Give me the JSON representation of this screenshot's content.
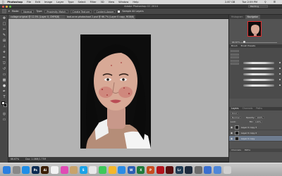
{
  "menubar": {
    "app_name": "Photoshop",
    "items": [
      "File",
      "Edit",
      "Image",
      "Layer",
      "Type",
      "Select",
      "Filter",
      "3D",
      "View",
      "Window",
      "Help"
    ],
    "status": [
      "2.87 GB",
      "Tue 2:59 PM"
    ]
  },
  "window": {
    "title": "Adobe Photoshop CC 2014",
    "workspace": "Painting"
  },
  "options_bar": {
    "mode_label": "Mode:",
    "mode_value": "Normal",
    "type_label": "Type:",
    "type_options": [
      "Proximity Match",
      "Create Texture",
      "Content-Aware"
    ],
    "sample_all_layers": "Sample All Layers"
  },
  "document": {
    "tab_label": "collage original @ 12.5% (Layer 0, CMYK/8)",
    "tab_label_2": "bad-acne-photoshoot 2.psd @ 66.7% (Layer 0 copy, RGB/8)",
    "status_zoom": "66.67%",
    "status_doc": "Doc: 1.06M/1.77M"
  },
  "panels": {
    "nav_tabs": [
      "Histogram",
      "Navigator"
    ],
    "nav_zoom": "66.67%",
    "brush_tabs": [
      "Brush",
      "Brush Presets"
    ],
    "layers_tabs": [
      "Layers",
      "Channels",
      "Paths"
    ],
    "layers_kind": "Kind",
    "blend_mode": "Normal",
    "opacity_label": "Opacity:",
    "opacity_value": "100%",
    "lock_label": "Lock:",
    "fill_label": "Fill:",
    "fill_value": "100%",
    "layers": [
      {
        "name": "Layer 0 copy 3",
        "selected": false
      },
      {
        "name": "Layer 0 copy 2",
        "selected": false
      },
      {
        "name": "Layer 0 copy",
        "selected": true
      }
    ],
    "footer_tabs": [
      "Channels",
      "Paths"
    ]
  },
  "dock": {
    "apps": [
      {
        "name": "finder-icon",
        "color": "#2a7fe0",
        "label": ""
      },
      {
        "name": "launchpad-icon",
        "color": "#888888",
        "label": ""
      },
      {
        "name": "safari-icon",
        "color": "#1f8ee8",
        "label": ""
      },
      {
        "name": "photoshop-icon",
        "color": "#0b2b52",
        "label": "Ps"
      },
      {
        "name": "illustrator-icon",
        "color": "#3b1e00",
        "label": "Ai"
      },
      {
        "name": "calendar-icon",
        "color": "#f2f2f2",
        "label": ""
      },
      {
        "name": "itunes-icon",
        "color": "#e04bb5",
        "label": ""
      },
      {
        "name": "contacts-icon",
        "color": "#c8a36b",
        "label": ""
      },
      {
        "name": "skype-icon",
        "color": "#1ba3e8",
        "label": "S"
      },
      {
        "name": "chrome-icon",
        "color": "#e8e8e8",
        "label": ""
      },
      {
        "name": "messages-icon",
        "color": "#3dc95a",
        "label": ""
      },
      {
        "name": "sketch-icon",
        "color": "#f5b72a",
        "label": ""
      },
      {
        "name": "app-store-icon",
        "color": "#2b8ce6",
        "label": ""
      },
      {
        "name": "word-icon",
        "color": "#2b5fb4",
        "label": "W"
      },
      {
        "name": "excel-icon",
        "color": "#1f7a3a",
        "label": "X"
      },
      {
        "name": "powerpoint-icon",
        "color": "#c84b1f",
        "label": "P"
      },
      {
        "name": "acrobat-icon",
        "color": "#b3121b",
        "label": ""
      },
      {
        "name": "flash-icon",
        "color": "#5a0f0f",
        "label": ""
      },
      {
        "name": "lightroom-icon",
        "color": "#1e3a52",
        "label": "Lr"
      },
      {
        "name": "steam-icon",
        "color": "#1c2a3c",
        "label": ""
      },
      {
        "name": "utility-icon",
        "color": "#6c6c6c",
        "label": ""
      },
      {
        "name": "downloads-icon",
        "color": "#3a6fd0",
        "label": ""
      },
      {
        "name": "documents-icon",
        "color": "#4f87d8",
        "label": ""
      },
      {
        "name": "trash-icon",
        "color": "#d0d0d0",
        "label": ""
      }
    ]
  }
}
